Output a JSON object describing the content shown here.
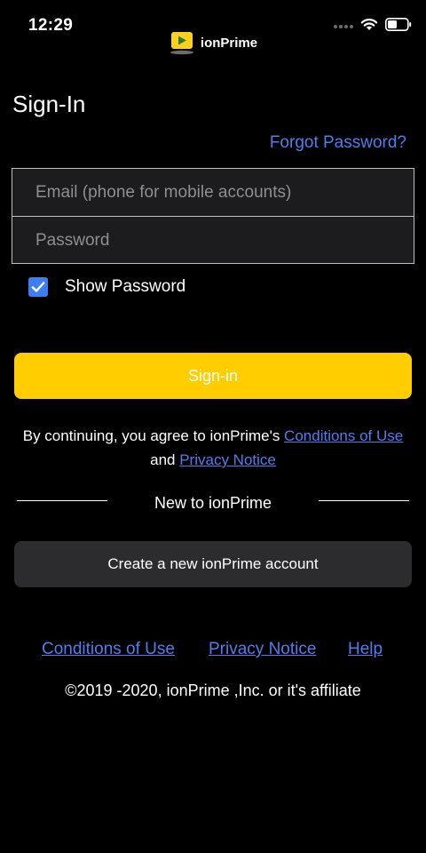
{
  "status_bar": {
    "time": "12:29",
    "signal_icon": "signal-dots-icon",
    "wifi_icon": "wifi-icon",
    "battery_icon": "battery-icon"
  },
  "brand": {
    "name": "ionPrime",
    "logo_icon": "play-tv-logo-icon",
    "logo_colors": {
      "screen": "#ffd11a",
      "play": "#2e7d32",
      "base": "#6d6d6d"
    }
  },
  "page": {
    "title": "Sign-In"
  },
  "forgot_password": {
    "label": "Forgot Password?"
  },
  "form": {
    "email_placeholder": "Email (phone for mobile accounts)",
    "password_placeholder": "Password",
    "email_value": "",
    "password_value": ""
  },
  "show_password": {
    "label": "Show Password",
    "checked": true
  },
  "signin_button": {
    "label": "Sign-in"
  },
  "legal": {
    "prefix": "By continuing, you agree to ionPrime's ",
    "conditions_link": "Conditions of Use",
    "and": " and ",
    "privacy_link": "Privacy Notice"
  },
  "new_divider": {
    "label": "New to ionPrime"
  },
  "create_button": {
    "label": "Create a new ionPrime account"
  },
  "footer": {
    "links": [
      "Conditions of Use",
      "Privacy Notice",
      "Help"
    ],
    "copyright": "©2019 -2020, ionPrime ,Inc. or it's affiliate"
  },
  "colors": {
    "background": "#000000",
    "link": "#4e7fee",
    "primary_button": "#ffcd00",
    "secondary_button": "#2c2c2e",
    "checkbox": "#3f7ef0"
  }
}
